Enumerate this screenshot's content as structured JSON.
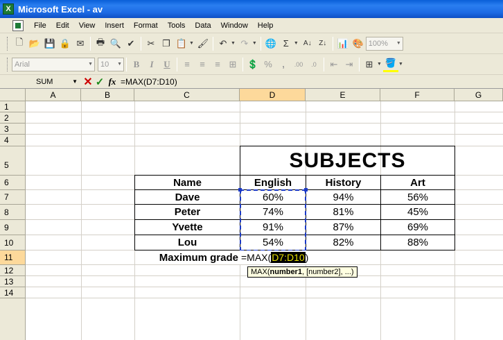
{
  "window": {
    "title": "Microsoft Excel - av",
    "app_icon_glyph": "X"
  },
  "menu": [
    "File",
    "Edit",
    "View",
    "Insert",
    "Format",
    "Tools",
    "Data",
    "Window",
    "Help"
  ],
  "standard_toolbar": {
    "zoom": "100%"
  },
  "formatting_toolbar": {
    "font": "Arial",
    "size": "10"
  },
  "formula_bar": {
    "name_box": "SUM",
    "cancel_glyph": "✕",
    "enter_glyph": "✓",
    "fx_label": "fx",
    "formula": "=MAX(D7:D10)"
  },
  "columns": [
    "A",
    "B",
    "C",
    "D",
    "E",
    "F",
    "G"
  ],
  "rows": [
    "1",
    "2",
    "3",
    "4",
    "5",
    "6",
    "7",
    "8",
    "9",
    "10",
    "11",
    "12",
    "13",
    "14"
  ],
  "table": {
    "title": "SUBJECTS",
    "headers": [
      "Name",
      "English",
      "History",
      "Art"
    ],
    "rows": [
      [
        "Dave",
        "60%",
        "94%",
        "56%"
      ],
      [
        "Peter",
        "74%",
        "81%",
        "45%"
      ],
      [
        "Yvette",
        "91%",
        "87%",
        "69%"
      ],
      [
        "Lou",
        "54%",
        "82%",
        "88%"
      ]
    ],
    "max_label": "Maximum grade"
  },
  "editing": {
    "prefix": "=MAX(",
    "reference": "D7:D10",
    "suffix": ")"
  },
  "tooltip": {
    "func": "MAX(",
    "arg1": "number1",
    "rest": ", [number2], ...)"
  },
  "colors": {
    "title_bar": "#1c6ae4",
    "chrome": "#ece9d8",
    "selection_header": "#fdd99b",
    "range_border": "#1a39c8",
    "tooltip_bg": "#ffffe1"
  }
}
